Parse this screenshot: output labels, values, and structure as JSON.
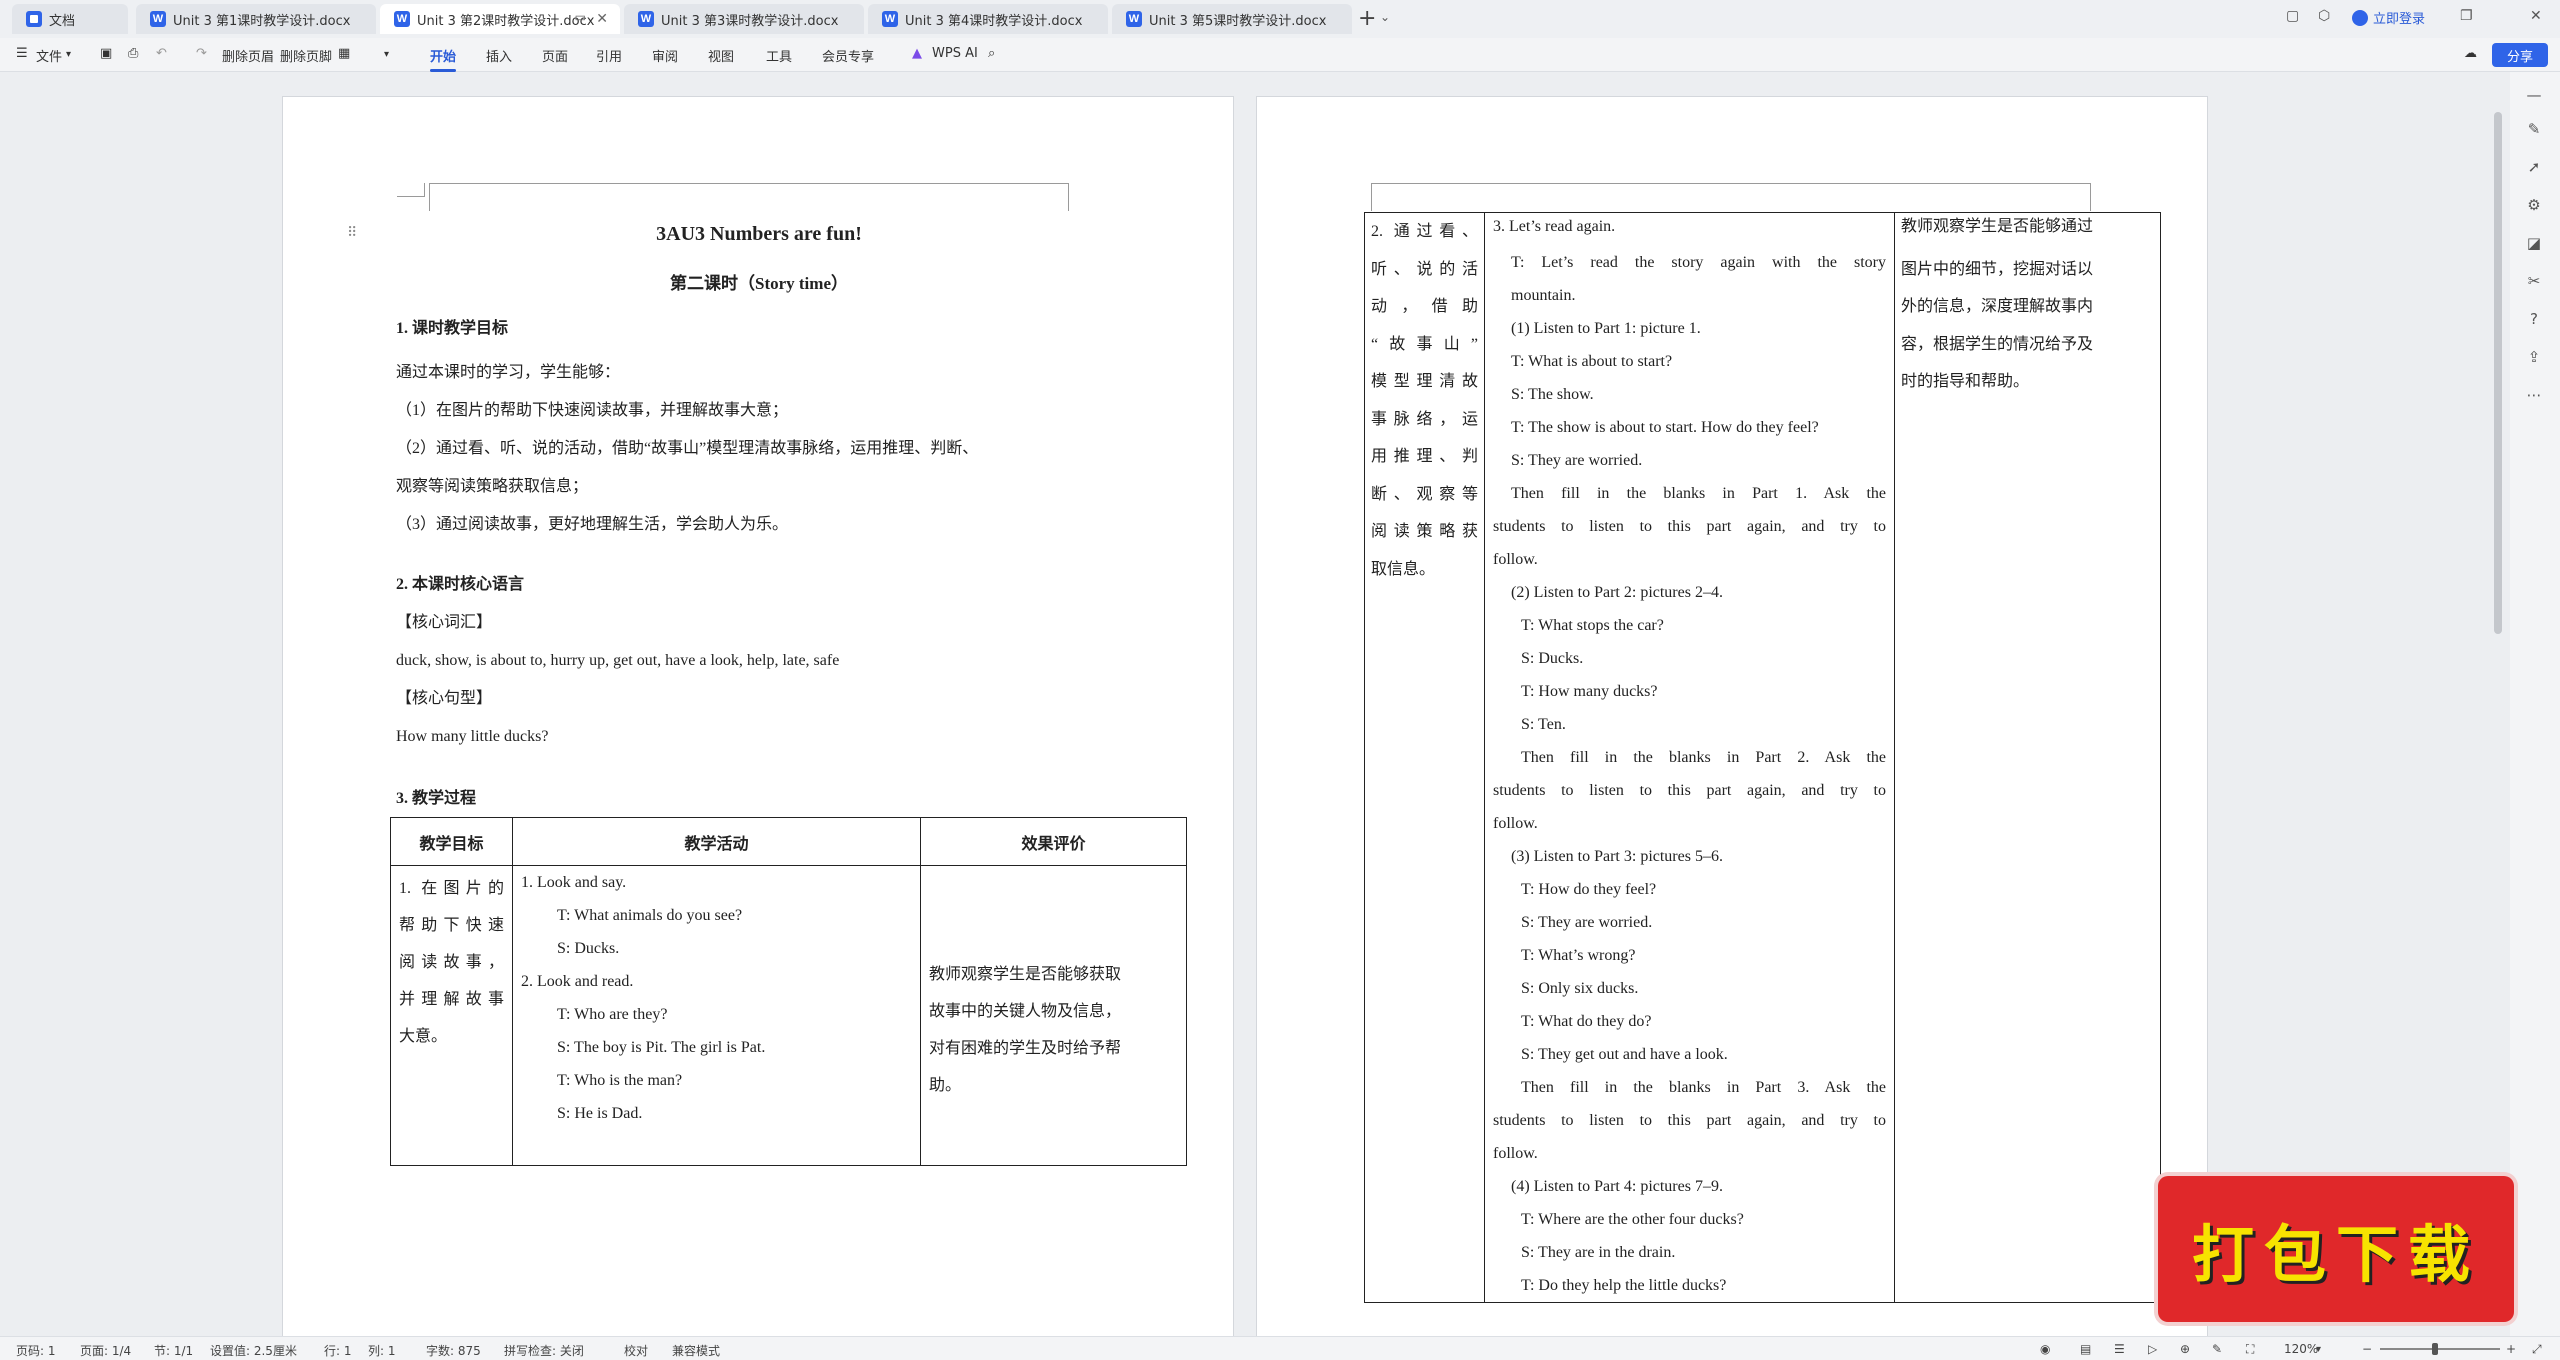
{
  "tabs": [
    {
      "label": "文档",
      "kind": "home"
    },
    {
      "label": "Unit 3 第1课时教学设计.docx",
      "kind": "word"
    },
    {
      "label": "Unit 3 第2课时教学设计.docx",
      "kind": "word",
      "active": true
    },
    {
      "label": "Unit 3 第3课时教学设计.docx",
      "kind": "word"
    },
    {
      "label": "Unit 3 第4课时教学设计.docx",
      "kind": "word"
    },
    {
      "label": "Unit 3 第5课时教学设计.docx",
      "kind": "word"
    }
  ],
  "titlebar": {
    "login": "立即登录",
    "new_tab": "+"
  },
  "toolbar": {
    "file": "文件",
    "delete_header": "删除页眉",
    "delete_footer": "删除页脚",
    "menus": [
      "开始",
      "插入",
      "页面",
      "引用",
      "审阅",
      "视图",
      "工具",
      "会员专享"
    ],
    "wps_ai": "WPS AI",
    "share": "分享"
  },
  "doc1": {
    "title": "3AU3 Numbers are fun!",
    "subtitle": "第二课时（Story time）",
    "s1_head": "1. 课时教学目标",
    "s1_lines": [
      "通过本课时的学习，学生能够：",
      "（1）在图片的帮助下快速阅读故事，并理解故事大意；",
      "（2）通过看、听、说的活动，借助“故事山”模型理清故事脉络，运用推理、判断、",
      "观察等阅读策略获取信息；",
      "（3）通过阅读故事，更好地理解生活，学会助人为乐。"
    ],
    "s2_head": "2. 本课时核心语言",
    "vocab_head": "【核心词汇】",
    "vocab": "duck, show, is about to, hurry up, get out, have a look, help, late, safe",
    "pattern_head": "【核心句型】",
    "pattern": "How many little ducks?",
    "s3_head": "3. 教学过程",
    "table_headers": [
      "教学目标",
      "教学活动",
      "效果评价"
    ],
    "row1_goal": [
      "1. 在图片的",
      "帮助下快速",
      "阅读故事，",
      "并理解故事",
      "大意。"
    ],
    "row1_activities": [
      "1.    Look and say.",
      "T: What animals do you see?",
      "S: Ducks.",
      "2.    Look and read.",
      "T: Who are they?",
      "S: The boy is Pit. The girl is Pat.",
      "T: Who is the man?",
      "S: He is Dad."
    ],
    "row1_eval": [
      "教师观察学生是否能够获取",
      "故事中的关键人物及信息，",
      "对有困难的学生及时给予帮",
      "助。"
    ]
  },
  "doc2": {
    "goal": [
      "2. 通过看、",
      "听、说的活",
      "动，借助",
      "“故事山”",
      "模型理清故",
      "事脉络，运",
      "用推理、判",
      "断、观察等",
      "阅读策略获",
      "取信息。"
    ],
    "activities": [
      "3. Let’s read again.",
      "T: Let’s read the story again with the story",
      "mountain.",
      "(1) Listen to Part 1: picture 1.",
      "T: What is about to start?",
      "S: The show.",
      "T: The show is about to start. How do they feel?",
      "S: They are worried.",
      "Then fill in the blanks in Part 1. Ask the",
      "students to listen to this part again, and try to",
      "follow.",
      "(2) Listen to Part 2: pictures 2–4.",
      "T: What stops the car?",
      "S: Ducks.",
      "T: How many ducks?",
      "S: Ten.",
      "Then fill in the blanks in Part 2. Ask the",
      "students to listen to this part again, and try to",
      "follow.",
      "(3) Listen to Part 3: pictures 5–6.",
      "T: How do they feel?",
      "S: They are worried.",
      "T: What’s wrong?",
      "S: Only six ducks.",
      "T: What do they do?",
      "S: They get out and have a look.",
      "Then fill in the blanks in Part 3. Ask the",
      "students to listen to this part again, and try to",
      "follow.",
      "(4) Listen to Part 4: pictures 7–9.",
      "T: Where are the other four ducks?",
      "S: They are in the drain.",
      "T: Do they help the little ducks?"
    ],
    "eval": [
      "教师观察学生是否能够通过",
      "图片中的细节，挖掘对话以",
      "外的信息，深度理解故事内",
      "容，根据学生的情况给予及",
      "时的指导和帮助。"
    ]
  },
  "status": {
    "page_num": "页码: 1",
    "pages": "页面: 1/4",
    "section": "节: 1/1",
    "setting": "设置值: 2.5厘米",
    "row": "行: 1",
    "col": "列: 1",
    "words": "字数: 875",
    "spell": "拼写检查: 关闭",
    "proof": "校对",
    "compat": "兼容模式",
    "zoom": "120%",
    "zoom_level_percent": 120
  },
  "download_badge": "打包下载",
  "colors": {
    "accent": "#2f64e8",
    "badge_bg": "#e0282a",
    "badge_text": "#f7e300"
  }
}
